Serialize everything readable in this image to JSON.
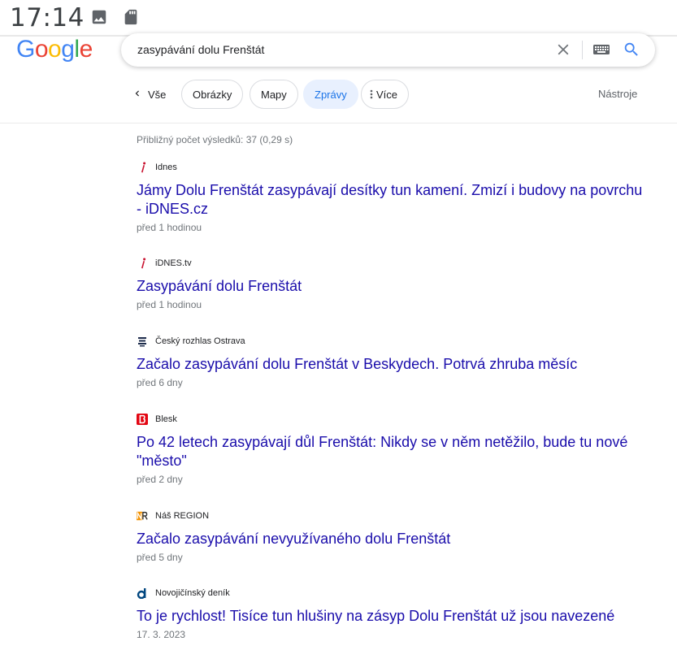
{
  "status_bar": {
    "time": "17:14",
    "icons": [
      "image-icon",
      "sd-card-icon"
    ]
  },
  "logo": {
    "text": "Google"
  },
  "search": {
    "query": "zasypávání dolu Frenštát",
    "clear_icon": "close-icon",
    "keyboard_icon": "keyboard-icon",
    "search_icon": "search-icon"
  },
  "tabs": {
    "back_label": "Vše",
    "items": [
      {
        "label": "Obrázky",
        "active": false
      },
      {
        "label": "Mapy",
        "active": false
      },
      {
        "label": "Zprávy",
        "active": true
      },
      {
        "label": "Více",
        "active": false
      }
    ],
    "tools_label": "Nástroje"
  },
  "results_stats": "Přibližný počet výsledků: 37 (0,29 s)",
  "results": [
    {
      "source": "Idnes",
      "title": "Jámy Dolu Frenštát zasypávají desítky tun kamení. Zmizí i budovy na povrchu - iDNES.cz",
      "time": "před 1 hodinou",
      "favicon": "idnes-icon"
    },
    {
      "source": "iDNES.tv",
      "title": "Zasypávání dolu Frenštát",
      "time": "před 1 hodinou",
      "favicon": "idnes-icon"
    },
    {
      "source": "Český rozhlas Ostrava",
      "title": "Začalo zasypávání dolu Frenštát v Beskydech. Potrvá zhruba měsíc",
      "time": "před 6 dny",
      "favicon": "rozhlas-icon"
    },
    {
      "source": "Blesk",
      "title": "Po 42 letech zasypávají důl Frenštát: Nikdy se v něm netěžilo, bude tu nové \"město\"",
      "time": "před 2 dny",
      "favicon": "blesk-icon"
    },
    {
      "source": "Náš REGION",
      "title": "Začalo zasypávání nevyužívaného dolu Frenštát",
      "time": "před 5 dny",
      "favicon": "nasregion-icon"
    },
    {
      "source": "Novojičínský deník",
      "title": "To je rychlost! Tisíce tun hlušiny na zásyp Dolu Frenštát už jsou navezené",
      "time": "17. 3. 2023",
      "favicon": "denik-icon"
    }
  ],
  "colors": {
    "link": "#1a0dab",
    "accent": "#1a73e8",
    "active_chip_bg": "#e8f0fe",
    "meta_text": "#70757a"
  }
}
